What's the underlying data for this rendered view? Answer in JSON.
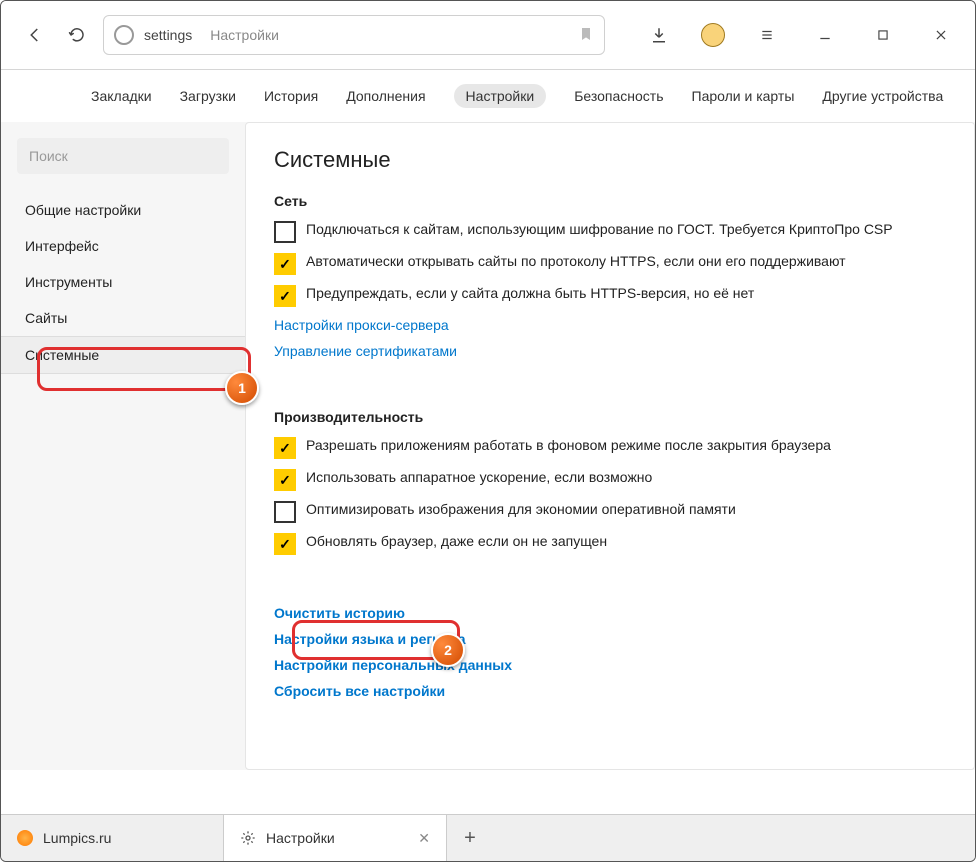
{
  "toolbar": {
    "url_host": "settings",
    "url_page": "Настройки"
  },
  "topnav": {
    "items": [
      "Закладки",
      "Загрузки",
      "История",
      "Дополнения",
      "Настройки",
      "Безопасность",
      "Пароли и карты",
      "Другие устройства"
    ],
    "active_index": 4
  },
  "sidebar": {
    "search_placeholder": "Поиск",
    "items": [
      "Общие настройки",
      "Интерфейс",
      "Инструменты",
      "Сайты",
      "Системные"
    ],
    "active_index": 4
  },
  "main": {
    "title": "Системные",
    "network": {
      "heading": "Сеть",
      "checks": [
        {
          "checked": false,
          "label": "Подключаться к сайтам, использующим шифрование по ГОСТ. Требуется КриптоПро CSP"
        },
        {
          "checked": true,
          "label": "Автоматически открывать сайты по протоколу HTTPS, если они его поддерживают"
        },
        {
          "checked": true,
          "label": "Предупреждать, если у сайта должна быть HTTPS-версия, но её нет"
        }
      ],
      "links": [
        "Настройки прокси-сервера",
        "Управление сертификатами"
      ]
    },
    "perf": {
      "heading": "Производительность",
      "checks": [
        {
          "checked": true,
          "label": "Разрешать приложениям работать в фоновом режиме после закрытия браузера"
        },
        {
          "checked": true,
          "label": "Использовать аппаратное ускорение, если возможно"
        },
        {
          "checked": false,
          "label": "Оптимизировать изображения для экономии оперативной памяти"
        },
        {
          "checked": true,
          "label": "Обновлять браузер, даже если он не запущен"
        }
      ]
    },
    "links2": [
      "Очистить историю",
      "Настройки языка и региона",
      "Настройки персональных данных",
      "Сбросить все настройки"
    ]
  },
  "tabs": {
    "items": [
      {
        "title": "Lumpics.ru",
        "icon": "sun"
      },
      {
        "title": "Настройки",
        "icon": "gear",
        "active": true
      }
    ]
  },
  "callouts": {
    "b1": "1",
    "b2": "2"
  }
}
